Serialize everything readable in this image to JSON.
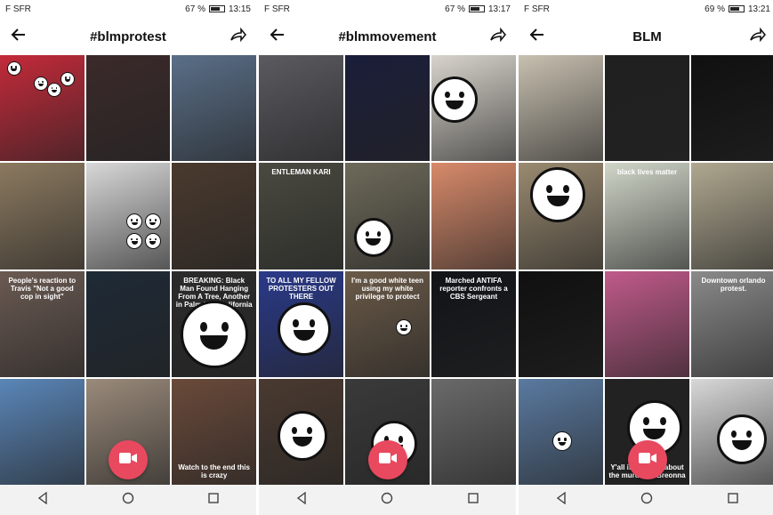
{
  "phones": [
    {
      "carrier": "F SFR",
      "battery": "67 %",
      "time": "13:15",
      "title": "#blmprotest",
      "captions": [
        "",
        "",
        "",
        "",
        "",
        "",
        "People's reaction to Travis \"Not a good cop in sight\"",
        "",
        "BREAKING: Black Man Found Hanging From A Tree, Another in Palmdale, California",
        "",
        "",
        "Watch to the end this is crazy"
      ]
    },
    {
      "carrier": "F SFR",
      "battery": "67 %",
      "time": "13:17",
      "title": "#blmmovement",
      "captions": [
        "",
        "",
        "",
        "ENTLEMAN KARI",
        "",
        "",
        "TO ALL MY FELLOW PROTESTERS OUT THERE",
        "I'm a good white teen using my white privilege to protect",
        "Marched ANTIFA reporter confronts a CBS Sergeant",
        "",
        "",
        ""
      ]
    },
    {
      "carrier": "F SFR",
      "battery": "69 %",
      "time": "13:21",
      "title": "BLM",
      "captions": [
        "",
        "",
        "",
        "",
        "black lives matter",
        "",
        "",
        "",
        "Downtown orlando protest.",
        "",
        "Y'all if you care about the murder of Breonna",
        ""
      ]
    }
  ],
  "icons": {
    "back": "arrow-left-icon",
    "share": "share-arrow-icon",
    "record": "video-camera-icon",
    "nav": [
      "back-triangle-icon",
      "home-circle-icon",
      "recents-square-icon"
    ]
  },
  "colors": {
    "record": "#e8495f",
    "header_text": "#111111"
  }
}
